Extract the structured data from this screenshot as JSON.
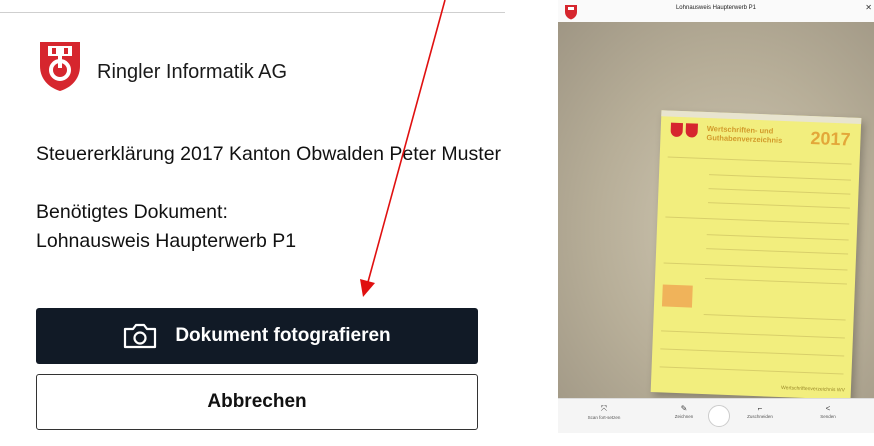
{
  "organization": {
    "name": "Ringler Informatik AG"
  },
  "request": {
    "title": "Steuererklärung 2017 Kanton Obwalden Peter Muster",
    "required_label": "Benötigtes Dokument:",
    "required_document": "Lohnausweis Haupterwerb P1"
  },
  "actions": {
    "photograph_label": "Dokument fotografieren",
    "cancel_label": "Abbrechen"
  },
  "camera_view": {
    "title": "Lohnausweis Haupterwerb P1",
    "document": {
      "heading_line1": "Wertschriften- und",
      "heading_line2": "Guthabenverzeichnis",
      "year": "2017",
      "footer": "Wertschriftenverzeichnis WV"
    },
    "toolbar": [
      {
        "icon": "auto-capture-icon",
        "label": "Scan fort-setzen"
      },
      {
        "icon": "pen-icon",
        "label": "Zeichnen"
      },
      {
        "icon": "crop-icon",
        "label": "Zuschneiden"
      },
      {
        "icon": "share-icon",
        "label": "Senden"
      }
    ]
  },
  "colors": {
    "primary_button": "#111a26",
    "annotation_arrow": "#e01010",
    "logo_red": "#d6262e"
  }
}
